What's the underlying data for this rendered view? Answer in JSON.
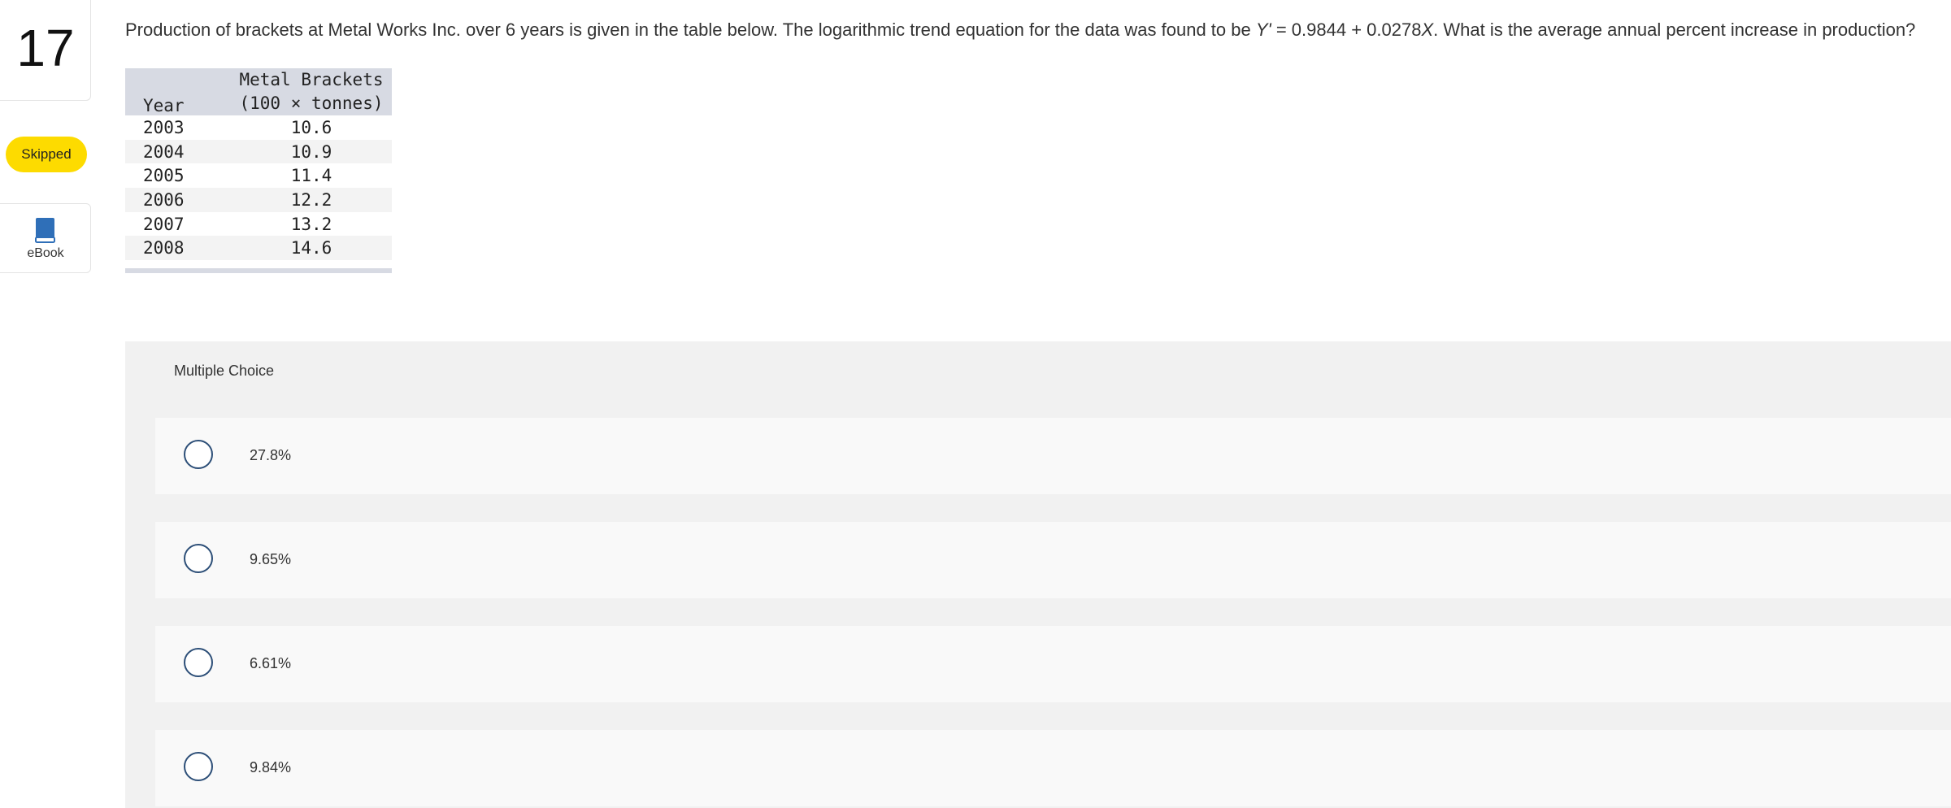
{
  "question_number": "17",
  "status_badge": "Skipped",
  "ebook": {
    "label": "eBook",
    "icon": "book-icon"
  },
  "question": {
    "text_pre": "Production of brackets at Metal Works Inc. over 6 years is given in the table below. The logarithmic trend equation for the data was found to be ",
    "equation_y": "Y'",
    "equation_mid": " = 0.9844 + 0.0278",
    "equation_x": "X",
    "text_post": ". What is the average annual percent increase in production?"
  },
  "table": {
    "headers": [
      "Year",
      "Metal Brackets",
      "(100 × tonnes)"
    ],
    "rows": [
      {
        "year": "2003",
        "value": "10.6"
      },
      {
        "year": "2004",
        "value": "10.9"
      },
      {
        "year": "2005",
        "value": "11.4"
      },
      {
        "year": "2006",
        "value": "12.2"
      },
      {
        "year": "2007",
        "value": "13.2"
      },
      {
        "year": "2008",
        "value": "14.6"
      }
    ]
  },
  "multiple_choice": {
    "label": "Multiple Choice",
    "options": [
      "27.8%",
      "9.65%",
      "6.61%",
      "9.84%"
    ]
  },
  "colors": {
    "badge": "#fddb00",
    "radio_border": "#2d4f78",
    "table_header": "#d7dae3"
  }
}
